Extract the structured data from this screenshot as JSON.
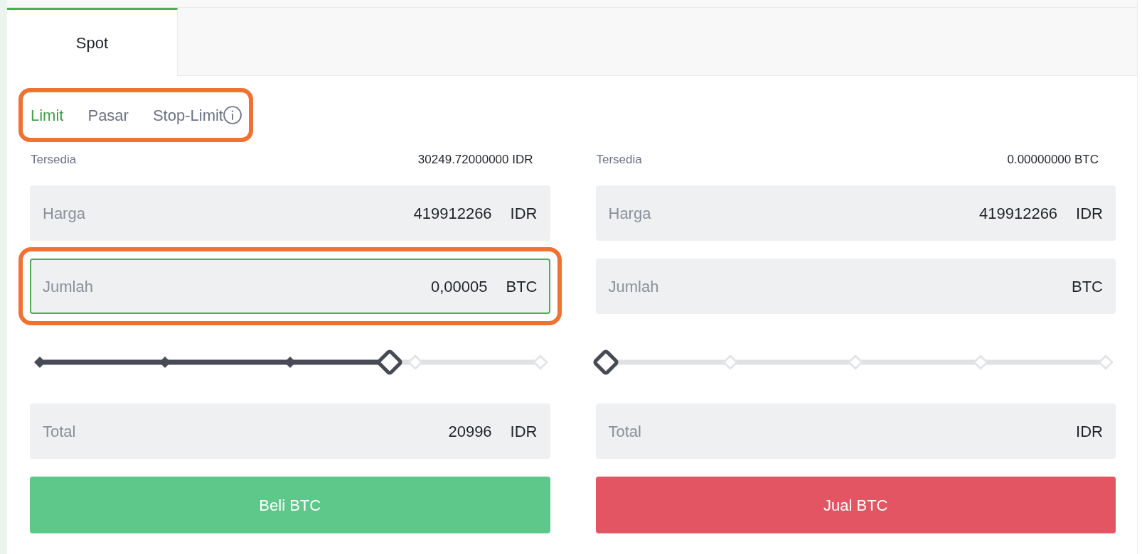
{
  "tabs": [
    {
      "label": "Spot",
      "selected": true
    }
  ],
  "order_types": {
    "highlighted": true,
    "items": [
      {
        "label": "Limit",
        "selected": true,
        "info": false
      },
      {
        "label": "Pasar",
        "selected": false,
        "info": false
      },
      {
        "label": "Stop-Limit",
        "selected": false,
        "info": true
      }
    ]
  },
  "forms": [
    {
      "available_label": "Tersedia",
      "available": "30249.72000000 IDR",
      "fields": [
        {
          "label": "Harga",
          "value": "419912266",
          "unit": "IDR",
          "focused": false,
          "highlighted": false
        },
        {
          "label": "Jumlah",
          "value": "0,00005",
          "unit": "BTC",
          "focused": true,
          "highlighted": true
        }
      ],
      "slider": {
        "level": 0.7
      },
      "total": {
        "label": "Total",
        "value": "20996",
        "unit": "IDR"
      },
      "button": {
        "label": "Beli BTC",
        "color": "#5ec88a"
      }
    },
    {
      "available_label": "Tersedia",
      "available": "0.00000000 BTC",
      "fields": [
        {
          "label": "Harga",
          "value": "419912266",
          "unit": "IDR",
          "focused": false,
          "highlighted": false
        },
        {
          "label": "Jumlah",
          "unit": "BTC",
          "focused": false,
          "highlighted": false
        }
      ],
      "slider": {
        "level": 0
      },
      "total": {
        "label": "Total",
        "unit": "IDR"
      },
      "button": {
        "label": "Jual BTC",
        "color": "#e35562"
      }
    }
  ]
}
